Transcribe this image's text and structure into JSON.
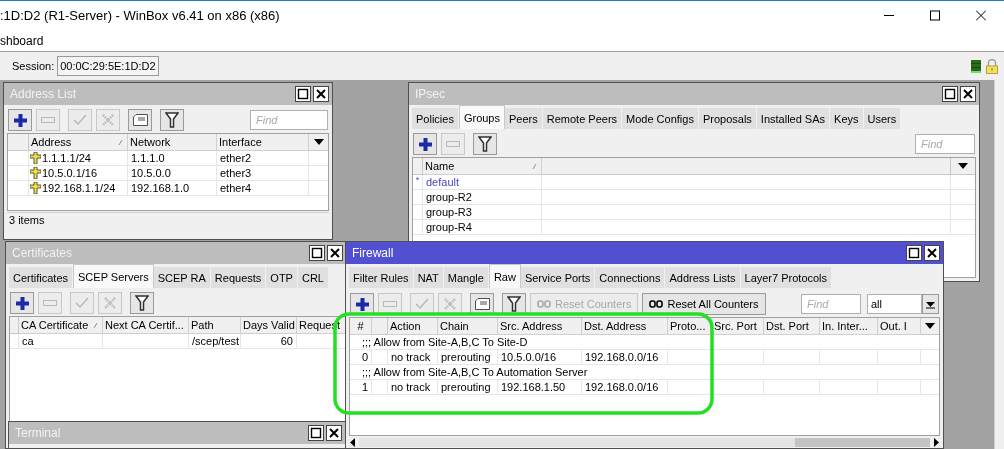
{
  "window": {
    "title": ":1D:D2 (R1-Server) - WinBox v6.41 on x86 (x86)"
  },
  "menu": {
    "label": "shboard"
  },
  "session": {
    "label": "Session:",
    "value": "00:0C:29:5E:1D:D2"
  },
  "address_list": {
    "title": "Address List",
    "active": false,
    "toolbar": [
      {
        "kind": "add",
        "disabled": false
      },
      {
        "kind": "remove",
        "disabled": true
      },
      {
        "kind": "enable",
        "disabled": true
      },
      {
        "kind": "disable",
        "disabled": true
      },
      {
        "kind": "comment",
        "disabled": false
      },
      {
        "kind": "filter",
        "disabled": false
      }
    ],
    "find": {
      "placeholder": "Find"
    },
    "columns": [
      {
        "label": "Address",
        "sorted": true
      },
      {
        "label": "Network",
        "sorted": false
      },
      {
        "label": "Interface",
        "sorted": false
      }
    ],
    "rows": [
      {
        "address": "1.1.1.1/24",
        "network": "1.1.1.0",
        "interface": "ether2"
      },
      {
        "address": "10.5.0.1/16",
        "network": "10.5.0.0",
        "interface": "ether3"
      },
      {
        "address": "192.168.1.1/24",
        "network": "192.168.1.0",
        "interface": "ether4"
      }
    ],
    "status": "3 items"
  },
  "ipsec": {
    "title": "IPsec",
    "active": false,
    "tabs": [
      {
        "label": "Policies",
        "selected": false
      },
      {
        "label": "Groups",
        "selected": true
      },
      {
        "label": "Peers",
        "selected": false
      },
      {
        "label": "Remote Peers",
        "selected": false
      },
      {
        "label": "Mode Configs",
        "selected": false
      },
      {
        "label": "Proposals",
        "selected": false
      },
      {
        "label": "Installed SAs",
        "selected": false
      },
      {
        "label": "Keys",
        "selected": false
      },
      {
        "label": "Users",
        "selected": false
      }
    ],
    "toolbar": [
      {
        "kind": "add",
        "disabled": false
      },
      {
        "kind": "remove",
        "disabled": true
      },
      {
        "kind": "filter",
        "disabled": false
      }
    ],
    "find": {
      "placeholder": "Find"
    },
    "columns": [
      {
        "label": "Name",
        "sorted": true
      }
    ],
    "rows": [
      {
        "flag": "*",
        "name": "default",
        "dynamic": true
      },
      {
        "name": "group-R2",
        "dynamic": false
      },
      {
        "name": "group-R3",
        "dynamic": false
      },
      {
        "name": "group-R4",
        "dynamic": false
      }
    ]
  },
  "certificates": {
    "title": "Certificates",
    "active": false,
    "tabs": [
      {
        "label": "Certificates",
        "selected": false
      },
      {
        "label": "SCEP Servers",
        "selected": true
      },
      {
        "label": "SCEP RA",
        "selected": false
      },
      {
        "label": "Requests",
        "selected": false
      },
      {
        "label": "OTP",
        "selected": false
      },
      {
        "label": "CRL",
        "selected": false
      }
    ],
    "toolbar": [
      {
        "kind": "add",
        "disabled": false
      },
      {
        "kind": "remove",
        "disabled": true
      },
      {
        "kind": "enable",
        "disabled": true
      },
      {
        "kind": "disable",
        "disabled": true
      },
      {
        "kind": "filter",
        "disabled": false
      }
    ],
    "columns": [
      {
        "label": "CA Certificate",
        "sorted": true
      },
      {
        "label": "Next CA Certif...",
        "sorted": false
      },
      {
        "label": "Path",
        "sorted": false
      },
      {
        "label": "Days Valid",
        "sorted": false
      },
      {
        "label": "Request",
        "sorted": false
      }
    ],
    "rows": [
      {
        "ca_certificate": "ca",
        "path": "/scep/test",
        "days_valid": "60"
      }
    ]
  },
  "terminal": {
    "title": "Terminal",
    "active": false
  },
  "firewall": {
    "title": "Firewall",
    "active": true,
    "tabs": [
      {
        "label": "Filter Rules",
        "selected": false
      },
      {
        "label": "NAT",
        "selected": false
      },
      {
        "label": "Mangle",
        "selected": false
      },
      {
        "label": "Raw",
        "selected": true
      },
      {
        "label": "Service Ports",
        "selected": false
      },
      {
        "label": "Connections",
        "selected": false
      },
      {
        "label": "Address Lists",
        "selected": false
      },
      {
        "label": "Layer7 Protocols",
        "selected": false
      }
    ],
    "toolbar": [
      {
        "kind": "add",
        "disabled": false
      },
      {
        "kind": "remove",
        "disabled": true
      },
      {
        "kind": "enable",
        "disabled": true
      },
      {
        "kind": "disable",
        "disabled": true
      },
      {
        "kind": "comment",
        "disabled": false
      },
      {
        "kind": "filter",
        "disabled": false
      }
    ],
    "buttons": [
      {
        "label": "Reset Counters",
        "disabled": true
      },
      {
        "label": "Reset All Counters",
        "disabled": false
      }
    ],
    "find": {
      "placeholder": "Find"
    },
    "filter_value": "all",
    "columns": [
      "#",
      "Action",
      "Chain",
      "Src. Address",
      "Dst. Address",
      "Proto...",
      "Src. Port",
      "Dst. Port",
      "In. Inter...",
      "Out. I"
    ],
    "rows": [
      {
        "kind": "comment",
        "text": ";;; Allow from Site-A,B,C To Site-D"
      },
      {
        "kind": "rule",
        "number": "0",
        "action": "no track",
        "chain": "prerouting",
        "src_address": "10.5.0.0/16",
        "dst_address": "192.168.0.0/16"
      },
      {
        "kind": "comment",
        "text": ";;; Allow from Site-A,B,C To Automation Server"
      },
      {
        "kind": "rule",
        "number": "1",
        "action": "no track",
        "chain": "prerouting",
        "src_address": "192.168.1.50",
        "dst_address": "192.168.0.0/16"
      }
    ]
  }
}
